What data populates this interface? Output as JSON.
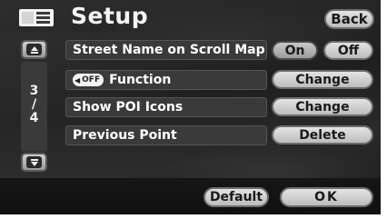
{
  "header": {
    "title": "Setup",
    "back_label": "Back",
    "menu_icon": "list-menu-icon"
  },
  "rows": [
    {
      "label": "Street Name on Scroll Map",
      "on_label": "On",
      "off_label": "Off",
      "selected": "On"
    },
    {
      "badge": "OFF",
      "badge_icon": "speaker-left-icon",
      "label": "Function",
      "action_label": "Change"
    },
    {
      "label": "Show POI Icons",
      "action_label": "Change"
    },
    {
      "label": "Previous Point",
      "action_label": "Delete"
    }
  ],
  "pager": {
    "current": "3",
    "separator": "/",
    "total": "4",
    "up_icon": "chevron-up-icon",
    "down_icon": "chevron-down-icon"
  },
  "footer": {
    "default_label": "Default",
    "ok_label": "OK"
  }
}
